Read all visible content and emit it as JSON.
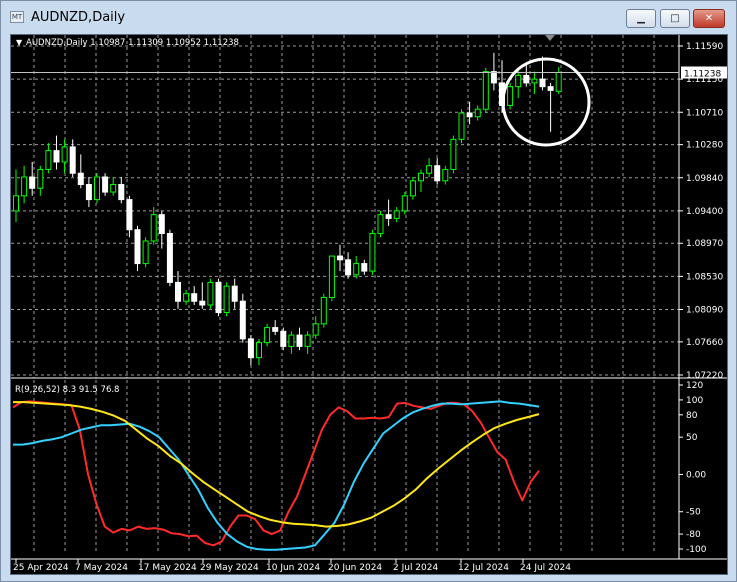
{
  "window": {
    "title": "AUDNZD,Daily",
    "app_icon_text": "MT",
    "min_glyph": "▁",
    "max_glyph": "□",
    "close_glyph": "✕"
  },
  "chart_data": [
    {
      "type": "candlestick",
      "symbol_label": "AUDNZD,Daily",
      "ohlc_label": "1.10987 1.11309 1.10952 1.11238",
      "ylim": [
        1.0722,
        1.1159
      ],
      "yticks": [
        "1.11590",
        "1.11150",
        "1.10710",
        "1.10280",
        "1.09840",
        "1.09400",
        "1.08970",
        "1.08530",
        "1.08090",
        "1.07660",
        "1.07220"
      ],
      "current_price": "1.11238",
      "bull_color": "#00ff00",
      "bear_color": "#ffffff",
      "grid": true,
      "candles": [
        [
          1.094,
          1.0995,
          1.0925,
          1.096
        ],
        [
          1.096,
          1.1,
          1.095,
          1.0985
        ],
        [
          1.0985,
          1.1005,
          1.096,
          1.097
        ],
        [
          1.097,
          1.1,
          1.096,
          1.0995
        ],
        [
          1.0995,
          1.103,
          1.099,
          1.102
        ],
        [
          1.102,
          1.104,
          1.0995,
          1.1005
        ],
        [
          1.1005,
          1.1035,
          1.099,
          1.1025
        ],
        [
          1.1025,
          1.1035,
          1.0985,
          1.099
        ],
        [
          1.099,
          1.1015,
          1.097,
          1.0975
        ],
        [
          1.0975,
          1.0985,
          1.0945,
          1.0955
        ],
        [
          1.0955,
          1.099,
          1.095,
          1.0985
        ],
        [
          1.0985,
          1.099,
          1.096,
          1.0965
        ],
        [
          1.0965,
          1.0985,
          1.096,
          1.0975
        ],
        [
          1.0975,
          1.0985,
          1.095,
          1.0955
        ],
        [
          1.0955,
          1.096,
          1.0905,
          1.0915
        ],
        [
          1.0915,
          1.092,
          1.086,
          1.087
        ],
        [
          1.087,
          1.0905,
          1.0865,
          1.09
        ],
        [
          1.09,
          1.0945,
          1.0895,
          1.0935
        ],
        [
          1.0935,
          1.094,
          1.089,
          1.091
        ],
        [
          1.091,
          1.0915,
          1.084,
          1.0845
        ],
        [
          1.0845,
          1.086,
          1.081,
          1.082
        ],
        [
          1.082,
          1.0835,
          1.0815,
          1.083
        ],
        [
          1.083,
          1.084,
          1.0815,
          1.082
        ],
        [
          1.082,
          1.0845,
          1.081,
          1.0815
        ],
        [
          1.0815,
          1.085,
          1.081,
          1.0845
        ],
        [
          1.0845,
          1.085,
          1.08,
          1.0805
        ],
        [
          1.0805,
          1.0845,
          1.08,
          1.084
        ],
        [
          1.084,
          1.085,
          1.081,
          1.082
        ],
        [
          1.082,
          1.083,
          1.0765,
          1.077
        ],
        [
          1.077,
          1.0775,
          1.0735,
          1.0745
        ],
        [
          1.0745,
          1.077,
          1.0735,
          1.0765
        ],
        [
          1.0765,
          1.079,
          1.076,
          1.0785
        ],
        [
          1.0785,
          1.0795,
          1.0775,
          1.078
        ],
        [
          1.078,
          1.0785,
          1.0755,
          1.076
        ],
        [
          1.076,
          1.078,
          1.075,
          1.0775
        ],
        [
          1.0775,
          1.0785,
          1.0755,
          1.076
        ],
        [
          1.076,
          1.078,
          1.075,
          1.0775
        ],
        [
          1.0775,
          1.08,
          1.077,
          1.079
        ],
        [
          1.079,
          1.083,
          1.0785,
          1.0825
        ],
        [
          1.0825,
          1.088,
          1.082,
          1.088
        ],
        [
          1.088,
          1.0895,
          1.086,
          1.0875
        ],
        [
          1.0875,
          1.0885,
          1.085,
          1.0855
        ],
        [
          1.0855,
          1.088,
          1.085,
          1.087
        ],
        [
          1.087,
          1.0875,
          1.0855,
          1.086
        ],
        [
          1.086,
          1.0915,
          1.0855,
          1.091
        ],
        [
          1.091,
          1.094,
          1.0905,
          1.0935
        ],
        [
          1.0935,
          1.0955,
          1.092,
          1.093
        ],
        [
          1.093,
          1.0945,
          1.0925,
          1.094
        ],
        [
          1.094,
          1.0965,
          1.0935,
          1.096
        ],
        [
          1.096,
          1.0985,
          1.0955,
          1.098
        ],
        [
          1.098,
          1.0995,
          1.0965,
          1.099
        ],
        [
          1.099,
          1.101,
          1.0985,
          1.1
        ],
        [
          1.1,
          1.101,
          1.0975,
          1.098
        ],
        [
          1.098,
          1.1,
          1.0975,
          1.0995
        ],
        [
          1.0995,
          1.104,
          1.099,
          1.1035
        ],
        [
          1.1035,
          1.1075,
          1.103,
          1.107
        ],
        [
          1.107,
          1.1085,
          1.1055,
          1.1065
        ],
        [
          1.1065,
          1.108,
          1.106,
          1.1075
        ],
        [
          1.1075,
          1.113,
          1.107,
          1.1125
        ],
        [
          1.1125,
          1.115,
          1.11,
          1.111
        ],
        [
          1.111,
          1.114,
          1.107,
          1.108
        ],
        [
          1.108,
          1.111,
          1.1075,
          1.1105
        ],
        [
          1.1105,
          1.113,
          1.109,
          1.112
        ],
        [
          1.112,
          1.1135,
          1.1105,
          1.111
        ],
        [
          1.111,
          1.1125,
          1.1095,
          1.1115
        ],
        [
          1.1115,
          1.1145,
          1.11,
          1.1105
        ],
        [
          1.1105,
          1.111,
          1.1045,
          1.11
        ],
        [
          1.10987,
          1.11309,
          1.10952,
          1.11238
        ]
      ],
      "x_dates": [
        "25 Apr 2024",
        "7 May 2024",
        "17 May 2024",
        "29 May 2024",
        "10 Jun 2024",
        "20 Jun 2024",
        "2 Jul 2024",
        "12 Jul 2024",
        "24 Jul 2024"
      ]
    },
    {
      "type": "line",
      "label": "R(9,26,52) 8.3 91.5 76.8",
      "ylim": [
        -100,
        120
      ],
      "yticks": [
        "120",
        "100",
        "80",
        "50",
        "0.00",
        "-50",
        "-80",
        "-100"
      ],
      "series": [
        {
          "color": "#ff2a2a",
          "values": [
            90,
            97,
            98,
            97,
            96,
            95,
            94,
            93,
            60,
            0,
            -40,
            -70,
            -78,
            -73,
            -75,
            -70,
            -73,
            -72,
            -74,
            -79,
            -80,
            -83,
            -82,
            -92,
            -95,
            -90,
            -70,
            -55,
            -55,
            -60,
            -75,
            -80,
            -75,
            -50,
            -30,
            0,
            30,
            60,
            80,
            90,
            85,
            75,
            75,
            76,
            75,
            77,
            95,
            96,
            92,
            90,
            88,
            92,
            96,
            96,
            94,
            85,
            70,
            50,
            30,
            20,
            -10,
            -35,
            -10,
            5
          ]
        },
        {
          "color": "#33d1ff",
          "values": [
            40,
            40,
            42,
            45,
            47,
            50,
            55,
            60,
            63,
            66,
            66,
            67,
            68,
            64,
            58,
            50,
            35,
            20,
            0,
            -20,
            -45,
            -65,
            -80,
            -90,
            -97,
            -100,
            -101,
            -101,
            -100,
            -99,
            -98,
            -95,
            -80,
            -65,
            -40,
            -10,
            15,
            35,
            55,
            65,
            75,
            83,
            88,
            92,
            95,
            95,
            94,
            95,
            96,
            97,
            98,
            96,
            95,
            93,
            91
          ]
        },
        {
          "color": "#ffe619",
          "values": [
            97,
            97,
            96,
            95,
            94,
            93,
            91,
            88,
            84,
            79,
            72,
            60,
            48,
            38,
            25,
            15,
            2,
            -10,
            -20,
            -30,
            -40,
            -50,
            -56,
            -61,
            -64,
            -66,
            -67,
            -68,
            -70,
            -69,
            -67,
            -63,
            -58,
            -50,
            -42,
            -32,
            -20,
            -5,
            8,
            20,
            32,
            43,
            53,
            62,
            68,
            73,
            77,
            81
          ]
        }
      ]
    }
  ],
  "annotation": {
    "type": "circle",
    "color": "#ffffff"
  }
}
